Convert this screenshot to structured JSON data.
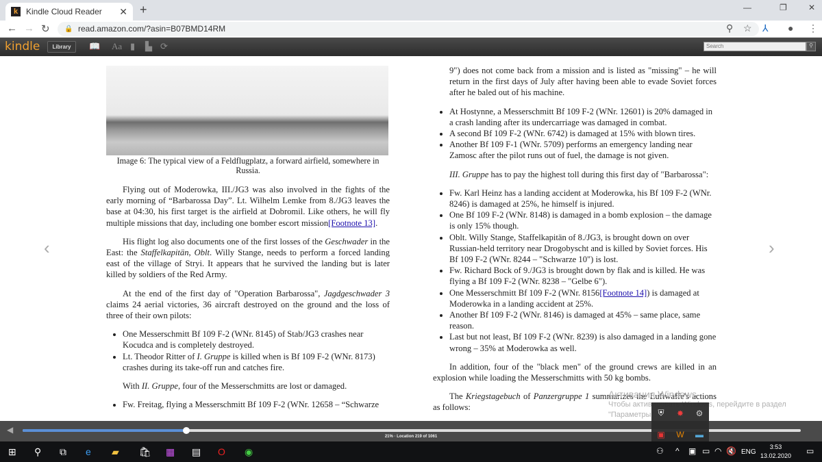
{
  "browser": {
    "tab_title": "Kindle Cloud Reader",
    "url": "read.amazon.com/?asin=B07BMD14RM",
    "favicon_letter": "k"
  },
  "kindle": {
    "logo": "kindle",
    "library_label": "Library",
    "search_placeholder": "Search"
  },
  "image": {
    "caption": "Image 6: The typical view of a Feldflugplatz, a forward airfield, somewhere in Russia."
  },
  "left_column": [
    {
      "type": "p",
      "segs": [
        {
          "t": "Flying out of Moderowka, III./JG3 was also involved in the fights of the early morning of “Barbarossa Day”. Lt. Wilhelm Lemke from 8./JG3 leaves the base at 04:30, his first target is the airfield at Dobromil. Like others, he will fly multiple missions that day, including one bomber escort mission"
        },
        {
          "t": "[Footnote 13]",
          "link": true
        },
        {
          "t": "."
        }
      ]
    },
    {
      "type": "p",
      "segs": [
        {
          "t": "His flight log also documents one of the first losses of the "
        },
        {
          "t": "Geschwader",
          "i": true
        },
        {
          "t": " in the East: the "
        },
        {
          "t": "Staffelkapitän",
          "i": true
        },
        {
          "t": ", "
        },
        {
          "t": "Oblt",
          "i": true
        },
        {
          "t": ". Willy Stange, needs to perform a forced landing east of the village of Stryi. It appears that he survived the landing but is later killed by soldiers of the Red Army."
        }
      ]
    },
    {
      "type": "p",
      "segs": [
        {
          "t": "At the end of the first day of \"Operation Barbarossa\", "
        },
        {
          "t": "Jagdgeschwader 3",
          "i": true
        },
        {
          "t": " claims 24 aerial victories, 36 aircraft destroyed on the ground and the loss of three of their own pilots:"
        }
      ]
    },
    {
      "type": "ul",
      "items": [
        [
          {
            "t": "One Messerschmitt Bf 109 F-2 (WNr. 8145) of Stab/JG3 crashes near Kocudca and is completely destroyed."
          }
        ],
        [
          {
            "t": "Lt. Theodor Ritter of "
          },
          {
            "t": "I. Gruppe",
            "i": true
          },
          {
            "t": " is killed when is Bf 109 F-2 (WNr. 8173) crashes during its take-off run and catches fire."
          }
        ]
      ]
    },
    {
      "type": "p",
      "segs": [
        {
          "t": "With "
        },
        {
          "t": "II. Gruppe",
          "i": true
        },
        {
          "t": ", four of the Messerschmitts are lost or damaged."
        }
      ]
    },
    {
      "type": "ul",
      "items": [
        [
          {
            "t": "Fw. Freitag, flying a Messerschmitt Bf 109 F-2 (WNr. 12658 – “Schwarze"
          }
        ]
      ]
    }
  ],
  "right_column": [
    {
      "type": "p",
      "noind": true,
      "segs": [
        {
          "t": "9\") does not come back from a mission and is listed as \"missing\" – he will return in the first days of July after having been able to evade Soviet forces after he baled out of his machine."
        }
      ],
      "cls": "cont"
    },
    {
      "type": "ul",
      "items": [
        [
          {
            "t": "At Hostynne, a Messerschmitt Bf 109 F-2 (WNr. 12601) is 20% damaged in a crash landing after its undercarriage was damaged in combat."
          }
        ],
        [
          {
            "t": "A second Bf 109 F-2 (WNr. 6742) is damaged at 15% with blown tires."
          }
        ],
        [
          {
            "t": "Another Bf 109 F-1 (WNr. 5709) performs an emergency landing near Zamosc after the pilot runs out of fuel, the damage is not given."
          }
        ]
      ]
    },
    {
      "type": "p",
      "segs": [
        {
          "t": "III. Gruppe",
          "i": true
        },
        {
          "t": " has to pay the highest toll during this first day of \"Barbarossa\":"
        }
      ]
    },
    {
      "type": "ul",
      "items": [
        [
          {
            "t": "Fw. Karl Heinz has a landing accident at Moderowka, his Bf 109 F-2 (WNr. 8246) is damaged at 25%, he himself is injured."
          }
        ],
        [
          {
            "t": "One Bf 109 F-2 (WNr. 8148) is damaged in a bomb explosion – the damage is only 15% though."
          }
        ],
        [
          {
            "t": "Oblt. Willy Stange, Staffelkapitän of 8./JG3, is brought down on over Russian-held territory near Drogobyscht and is killed by Soviet forces. His Bf 109 F-2 (WNr. 8244 – \"Schwarze 10\") is lost."
          }
        ],
        [
          {
            "t": "Fw. Richard Bock of 9./JG3 is brought down by flak and is killed. He was flying a Bf 109 F-2 (WNr. 8238 – \"Gelbe 6\")."
          }
        ],
        [
          {
            "t": "One Messerschmitt Bf 109 F-2 (WNr. 8156"
          },
          {
            "t": "[Footnote 14]",
            "link": true
          },
          {
            "t": ") is damaged at Moderowka in a landing accident at 25%."
          }
        ],
        [
          {
            "t": "Another Bf 109 F-2 (WNr. 8146) is damaged at 45% – same place, same reason."
          }
        ],
        [
          {
            "t": "Last but not least, Bf 109 F-2 (WNr. 8239) is also damaged in a landing gone wrong – 35% at Moderowka as well."
          }
        ]
      ]
    },
    {
      "type": "p",
      "segs": [
        {
          "t": "In addition, four of the \"black men\" of the ground crews are killed in an explosion while loading the Messerschmitts with 50 kg bombs."
        }
      ]
    },
    {
      "type": "p",
      "segs": [
        {
          "t": "The "
        },
        {
          "t": "Kriegstagebuch",
          "i": true
        },
        {
          "t": " of "
        },
        {
          "t": "Panzergruppe 1",
          "i": true
        },
        {
          "t": " summarizes the Luftwaffe's actions as follows:"
        }
      ]
    }
  ],
  "progress": {
    "percent": 21,
    "label": "21% · Location 219 of 1061"
  },
  "watermark": {
    "line1": "Активация Windows",
    "line2": "Чтобы активировать Windows, перейдите в раздел",
    "line3": "\"Параметры\"."
  },
  "taskbar": {
    "language": "ENG",
    "time": "3:53",
    "date": "13.02.2020"
  }
}
